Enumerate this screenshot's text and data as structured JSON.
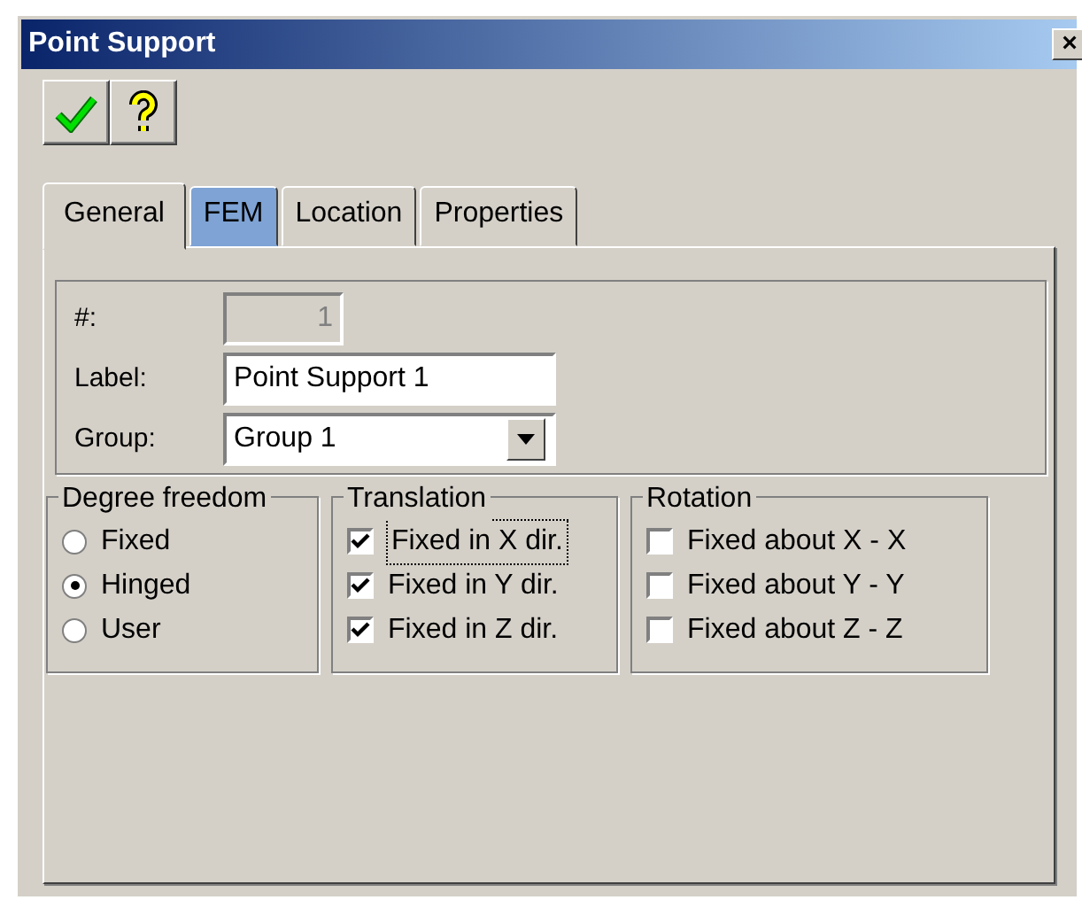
{
  "window": {
    "title": "Point Support",
    "close": "×"
  },
  "toolbar": [
    {
      "kind": "ok"
    },
    {
      "kind": "help"
    }
  ],
  "tabs": [
    {
      "label": "General",
      "selected": true,
      "highlighted": false
    },
    {
      "label": "FEM",
      "selected": false,
      "highlighted": true
    },
    {
      "label": "Location",
      "selected": false,
      "highlighted": false
    },
    {
      "label": "Properties",
      "selected": false,
      "highlighted": false
    }
  ],
  "fields": [
    {
      "label": "#:",
      "kind": "number",
      "value": "1"
    },
    {
      "label": "Label:",
      "kind": "text",
      "value": "Point Support 1"
    },
    {
      "label": "Group:",
      "kind": "combo",
      "value": "Group 1"
    }
  ],
  "degree_freedom": {
    "title": "Degree freedom",
    "options": [
      {
        "label": "Fixed",
        "selected": false
      },
      {
        "label": "Hinged",
        "selected": true
      },
      {
        "label": "User",
        "selected": false
      }
    ]
  },
  "translation": {
    "title": "Translation",
    "options": [
      {
        "label": "Fixed in X dir.",
        "checked": true,
        "focused": true
      },
      {
        "label": "Fixed in Y dir.",
        "checked": true,
        "focused": false
      },
      {
        "label": "Fixed in Z dir.",
        "checked": true,
        "focused": false
      }
    ]
  },
  "rotation": {
    "title": "Rotation",
    "options": [
      {
        "label": "Fixed about X - X",
        "checked": false,
        "focused": false
      },
      {
        "label": "Fixed about Y - Y",
        "checked": false,
        "focused": false
      },
      {
        "label": "Fixed about Z - Z",
        "checked": false,
        "focused": false
      }
    ]
  }
}
